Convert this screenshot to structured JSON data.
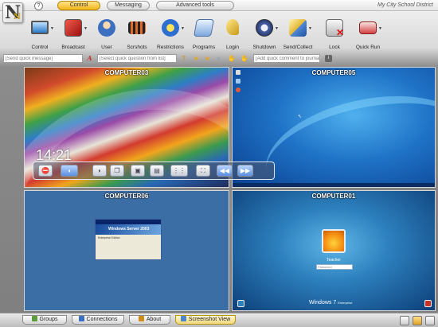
{
  "window": {
    "district": "My City School District"
  },
  "tabs": [
    {
      "label": "Control",
      "active": true
    },
    {
      "label": "Messaging",
      "active": false
    },
    {
      "label": "Advanced tools",
      "active": false
    }
  ],
  "help_label": "?",
  "toolbar": {
    "items": [
      {
        "label": "Control",
        "icon": "monitor-icon"
      },
      {
        "label": "Broadcast",
        "icon": "broadcast-icon"
      },
      {
        "label": "User",
        "icon": "user-icon"
      },
      {
        "label": "Scrshots",
        "icon": "film-icon"
      },
      {
        "label": "Restrictions",
        "icon": "restrictions-icon"
      },
      {
        "label": "Programs",
        "icon": "programs-icon"
      },
      {
        "label": "Login",
        "icon": "key-icon"
      },
      {
        "label": "Shutdown",
        "icon": "power-icon"
      },
      {
        "label": "Send/Collect",
        "icon": "send-collect-icon"
      },
      {
        "label": "Lock",
        "icon": "lock-icon"
      },
      {
        "label": "Quick Run",
        "icon": "quick-run-icon"
      }
    ]
  },
  "quickbar": {
    "message_placeholder": "[Send quick message]",
    "question_placeholder": "[Select quick question from list]",
    "journal_placeholder": "[Add quick comment to journal]"
  },
  "screens": [
    {
      "name": "COMPUTER03",
      "clock": "14:21"
    },
    {
      "name": "COMPUTER05"
    },
    {
      "name": "COMPUTER06",
      "dialog_title": "Windows Server 2003",
      "dialog_edition": "Enterprise Edition"
    },
    {
      "name": "COMPUTER01",
      "username": "Teacher",
      "password_placeholder": "Password",
      "os_label": "Windows",
      "os_version": "7",
      "os_edition": "Enterprise"
    }
  ],
  "bottom_tabs": [
    {
      "label": "Groups"
    },
    {
      "label": "Connections"
    },
    {
      "label": "About"
    },
    {
      "label": "Screenshot View",
      "active": true
    }
  ],
  "colors": {
    "accent": "#f3b619",
    "toolbar_bg": "#d9d9d9",
    "desktop_blue": "#1f73c7"
  }
}
